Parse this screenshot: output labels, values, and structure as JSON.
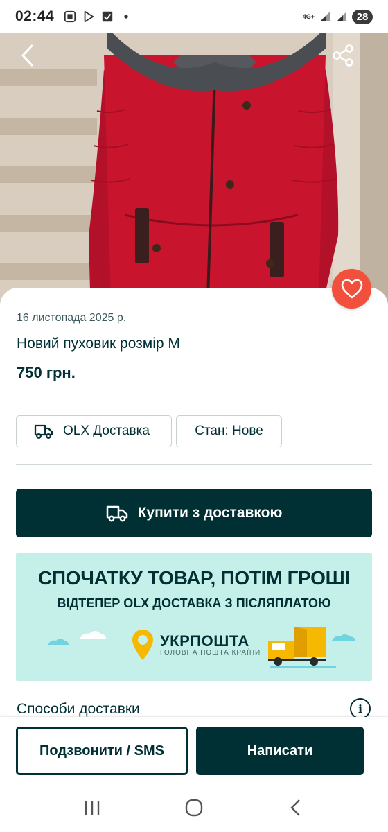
{
  "status_bar": {
    "time": "02:44",
    "network": "4G+",
    "battery": "28",
    "icons": [
      "screenshot-icon",
      "play-store-icon",
      "check-box-icon",
      "dot-icon",
      "wifi-signal-icon",
      "cell-signal-icon"
    ]
  },
  "photo": {
    "subject": "red-puffer-coat-with-fur-hood",
    "colors": {
      "coat": "#c9142e",
      "fur": "#4a4d52",
      "wall": "#d8cdbf"
    }
  },
  "listing": {
    "date": "16 листопада 2025 р.",
    "title": "Новий пуховик розмір М",
    "price": "750 грн.",
    "chips": {
      "delivery": "OLX Доставка",
      "condition": "Стан: Нове"
    },
    "buy_button": "Купити з доставкою"
  },
  "banner": {
    "headline": "СПОЧАТКУ ТОВАР, ПОТІМ ГРОШІ",
    "subheadline": "ВІДТЕПЕР OLX ДОСТАВКА З ПІСЛЯПЛАТОЮ",
    "brand": "УКРПОШТА",
    "tagline": "ГОЛОВНА ПОШТА КРАЇНИ",
    "colors": {
      "background": "#c5f0e9",
      "brand_yellow": "#f6b800"
    }
  },
  "delivery_section": {
    "title": "Способи доставки"
  },
  "actions": {
    "call": "Подзвонити / SMS",
    "message": "Написати"
  },
  "colors": {
    "primary": "#002f34",
    "favorite": "#f0503c"
  }
}
